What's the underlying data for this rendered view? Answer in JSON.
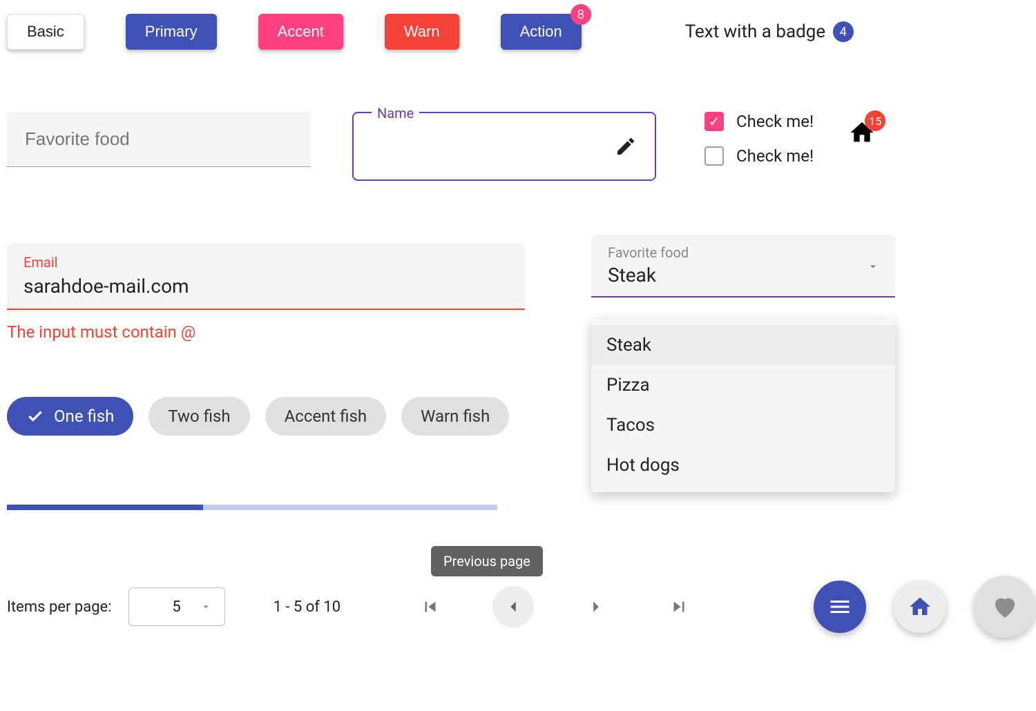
{
  "buttons": {
    "basic": "Basic",
    "primary": "Primary",
    "accent": "Accent",
    "warn": "Warn",
    "action": "Action",
    "action_badge": "8"
  },
  "badge_text": {
    "label": "Text with a badge",
    "count": "4"
  },
  "inputs": {
    "favorite_food_placeholder": "Favorite food",
    "name_label": "Name"
  },
  "checks": {
    "check1": "Check me!",
    "check2": "Check me!",
    "home_badge": "15"
  },
  "email": {
    "label": "Email",
    "value": "sarahdoe-mail.com",
    "error": "The input must contain @"
  },
  "chips": [
    "One fish",
    "Two fish",
    "Accent fish",
    "Warn fish"
  ],
  "progress_percent": 40,
  "select": {
    "label": "Favorite food",
    "value": "Steak",
    "options": [
      "Steak",
      "Pizza",
      "Tacos",
      "Hot dogs"
    ]
  },
  "paginator": {
    "items_label": "Items per page:",
    "page_size": "5",
    "range": "1 - 5 of 10",
    "tooltip": "Previous page"
  }
}
